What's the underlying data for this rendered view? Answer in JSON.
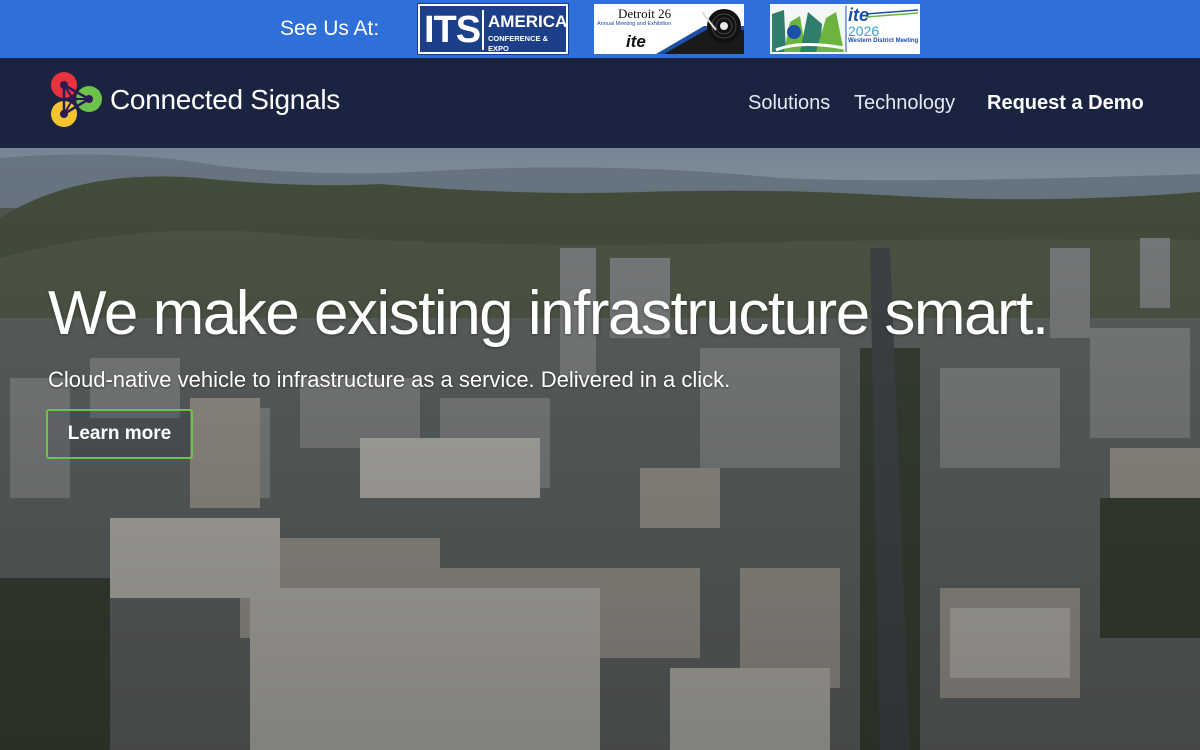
{
  "events_bar": {
    "label": "See Us At:",
    "logos": [
      {
        "name": "its-america-logo",
        "big": "ITS",
        "line1": "AMERICA",
        "line2": "CONFERENCE & EXPO"
      },
      {
        "name": "detroit-ite-logo",
        "title": "Detroit 26",
        "sub": "Annual Meeting and Exhibition",
        "mark": "ite"
      },
      {
        "name": "ite-western-district-logo",
        "mark": "ite",
        "year": "2026",
        "sub": "Western District Meeting"
      }
    ],
    "colors": {
      "background": "#2f6fd8"
    }
  },
  "nav": {
    "brand": "Connected Signals",
    "links": [
      "Solutions",
      "Technology",
      "Request a Demo"
    ],
    "colors": {
      "background": "#1a2440",
      "logo_red": "#e8323f",
      "logo_green": "#6cc24a",
      "logo_yellow": "#f4c430"
    }
  },
  "hero": {
    "title": "We make existing infrastructure smart.",
    "subtitle": "Cloud-native vehicle to infrastructure as a service. Delivered in a click.",
    "cta": "Learn more",
    "background_image": "aerial-city-photo",
    "colors": {
      "cta_border": "#6cc24a"
    }
  }
}
